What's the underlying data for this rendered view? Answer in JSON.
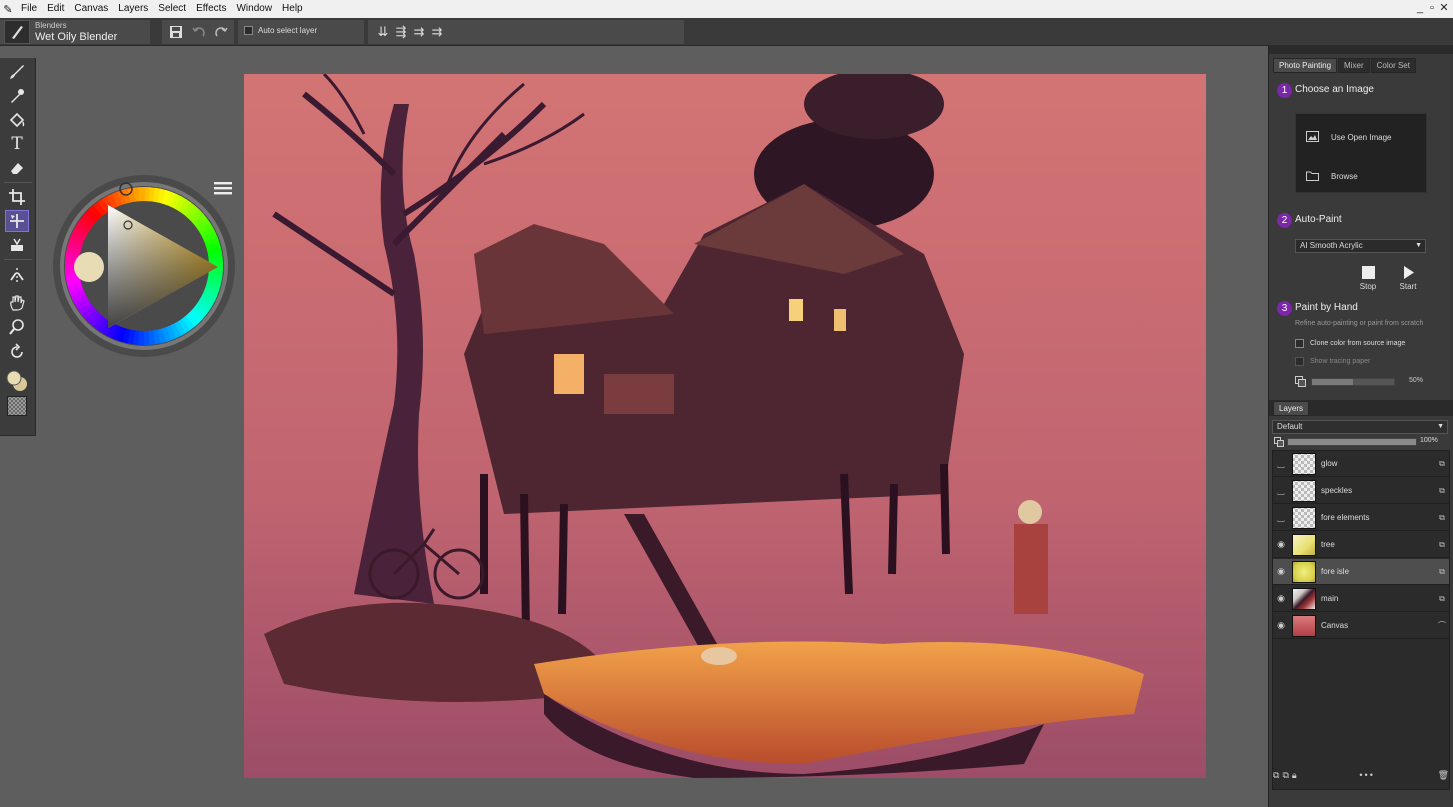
{
  "menu": {
    "items": [
      "File",
      "Edit",
      "Canvas",
      "Layers",
      "Select",
      "Effects",
      "Window",
      "Help"
    ],
    "window_controls": [
      "_",
      "▫",
      "✕"
    ]
  },
  "property_bar": {
    "brush_category": "Blenders",
    "brush_name": "Wet Oily Blender",
    "auto_select_label": "Auto select layer"
  },
  "right_panel": {
    "tabs": [
      "Photo Painting",
      "Mixer",
      "Color Set"
    ],
    "steps": [
      {
        "num": "1",
        "title": "Choose an Image"
      },
      {
        "num": "2",
        "title": "Auto-Paint"
      },
      {
        "num": "3",
        "title": "Paint by Hand"
      }
    ],
    "use_open_image": "Use Open Image",
    "browse": "Browse",
    "auto_paint_preset": "AI Smooth Acrylic",
    "stop_label": "Stop",
    "start_label": "Start",
    "paint_by_hand_hint": "Refine auto-painting or paint from scratch",
    "clone_color_label": "Clone color from source image",
    "tracing_paper_label": "Show tracing paper",
    "tracing_percent": "50%",
    "tracing_level": 0.5
  },
  "layers_panel": {
    "tab": "Layers",
    "composite_method": "Default",
    "opacity": "100%",
    "opacity_level": 1.0,
    "layers": [
      {
        "name": "glow",
        "visible": false,
        "thumb": "checker"
      },
      {
        "name": "speckles",
        "visible": false,
        "thumb": "checker"
      },
      {
        "name": "fore elements",
        "visible": false,
        "thumb": "checker"
      },
      {
        "name": "tree",
        "visible": true,
        "thumb": "tree"
      },
      {
        "name": "fore isle",
        "visible": true,
        "thumb": "isle",
        "selected": true
      },
      {
        "name": "main",
        "visible": true,
        "thumb": "main"
      },
      {
        "name": "Canvas",
        "visible": true,
        "thumb": "canvas"
      }
    ]
  },
  "colors": {
    "accent_purple": "#7a27a8",
    "current_color": "#e8dcb5",
    "painting_bg": "#c26a6d",
    "selected_hue": "#e2b12a"
  }
}
